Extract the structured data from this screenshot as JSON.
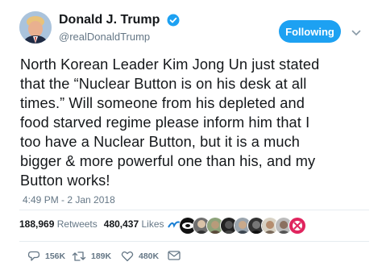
{
  "author": {
    "display_name": "Donald J. Trump",
    "handle": "@realDonaldTrump",
    "verified": true
  },
  "follow_button": {
    "label": "Following"
  },
  "tweet": {
    "lines": [
      "North Korean Leader Kim Jong Un just stated",
      "that the “Nuclear Button is on his desk at all",
      "times.” Will someone from his depleted and",
      "food starved regime please inform him that I",
      "too have a Nuclear Button, but it is a much",
      "bigger & more powerful one than his, and my",
      "Button works!"
    ],
    "timestamp": "4:49 PM - 2 Jan 2018"
  },
  "stats": {
    "retweets_count": "188,969",
    "retweets_label": "Retweets",
    "likes_count": "480,437",
    "likes_label": "Likes"
  },
  "likers_avatars": 10,
  "actions": {
    "reply_count": "156K",
    "retweet_count": "189K",
    "like_count": "480K"
  },
  "colors": {
    "accent": "#1da1f2",
    "text": "#14171a",
    "muted": "#657786",
    "divider": "#e6ecf0"
  }
}
